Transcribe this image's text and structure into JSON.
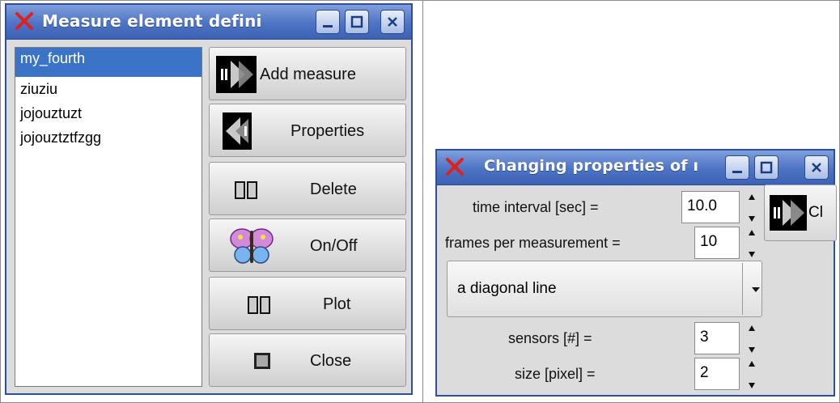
{
  "left_window": {
    "title": "Measure element defini",
    "list_items": [
      "my_fourth",
      "ziuziu",
      "jojouztuzt",
      "jojouztztfzgg"
    ],
    "selected_index": 0,
    "buttons": {
      "add_measure": "Add measure",
      "properties": "Properties",
      "delete": "Delete",
      "on_off": "On/Off",
      "plot": "Plot",
      "close": "Close"
    }
  },
  "right_window": {
    "title": "Changing properties of ı",
    "time_interval_label": "time interval [sec] =",
    "time_interval_value": "10.0",
    "frames_label": "frames per measurement =",
    "frames_value": "10",
    "shape_selected": "a diagonal line",
    "sensors_label": "sensors [#] =",
    "sensors_value": "3",
    "size_label": "size [pixel] =",
    "size_value": "2",
    "close_button_partial": "Cl"
  },
  "icons": {
    "close_x": "red-x-icon",
    "minimize": "minimize-icon",
    "maximize": "maximize-icon",
    "close": "close-icon"
  },
  "colors": {
    "titlebar": "#4d73c4",
    "selection": "#3b74c7",
    "close_x": "#e0201c"
  }
}
